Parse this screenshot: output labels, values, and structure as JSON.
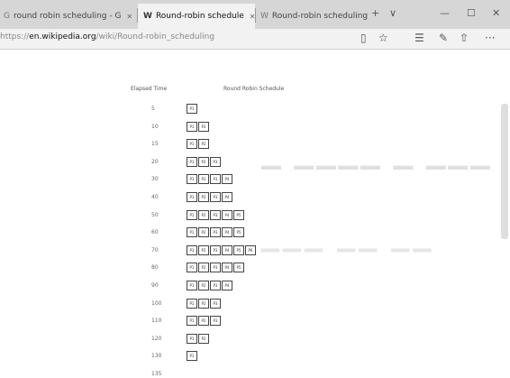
{
  "browser": {
    "tabs": [
      {
        "label": "round robin scheduling - G",
        "icon": "search-icon",
        "active": false
      },
      {
        "label": "Round-robin schedule",
        "icon": "wikipedia-w-icon",
        "active": true
      },
      {
        "label": "Round-robin scheduling",
        "icon": "wikipedia-w-icon",
        "active": false
      }
    ],
    "url_prefix": "https://",
    "url_domain": "en.wikipedia.org",
    "url_path": "/wiki/Round-robin_scheduling"
  },
  "table": {
    "time_header": "Elapsed Time",
    "schedule_header": "Round Robin Schedule",
    "rows": [
      {
        "time": "5",
        "procs": [
          "P1"
        ]
      },
      {
        "time": "10",
        "procs": [
          "P1",
          "P2"
        ]
      },
      {
        "time": "15",
        "procs": [
          "P1",
          "P2"
        ]
      },
      {
        "time": "20",
        "procs": [
          "P1",
          "P2",
          "P3"
        ]
      },
      {
        "time": "30",
        "procs": [
          "P1",
          "P2",
          "P3",
          "P4"
        ]
      },
      {
        "time": "40",
        "procs": [
          "P1",
          "P2",
          "P3",
          "P4"
        ]
      },
      {
        "time": "50",
        "procs": [
          "P1",
          "P2",
          "P3",
          "P4",
          "P5"
        ]
      },
      {
        "time": "60",
        "procs": [
          "P1",
          "P2",
          "P3",
          "P4",
          "P5"
        ]
      },
      {
        "time": "70",
        "procs": [
          "P1",
          "P2",
          "P3",
          "P4",
          "P5",
          "P6"
        ]
      },
      {
        "time": "80",
        "procs": [
          "P1",
          "P2",
          "P3",
          "P4",
          "P5"
        ]
      },
      {
        "time": "90",
        "procs": [
          "P1",
          "P2",
          "P3",
          "P4"
        ]
      },
      {
        "time": "100",
        "procs": [
          "P1",
          "P2",
          "P3"
        ]
      },
      {
        "time": "110",
        "procs": [
          "P1",
          "P2",
          "P3"
        ]
      },
      {
        "time": "120",
        "procs": [
          "P1",
          "P2"
        ]
      },
      {
        "time": "130",
        "procs": [
          "P1"
        ]
      },
      {
        "time": "135",
        "procs": []
      }
    ]
  }
}
